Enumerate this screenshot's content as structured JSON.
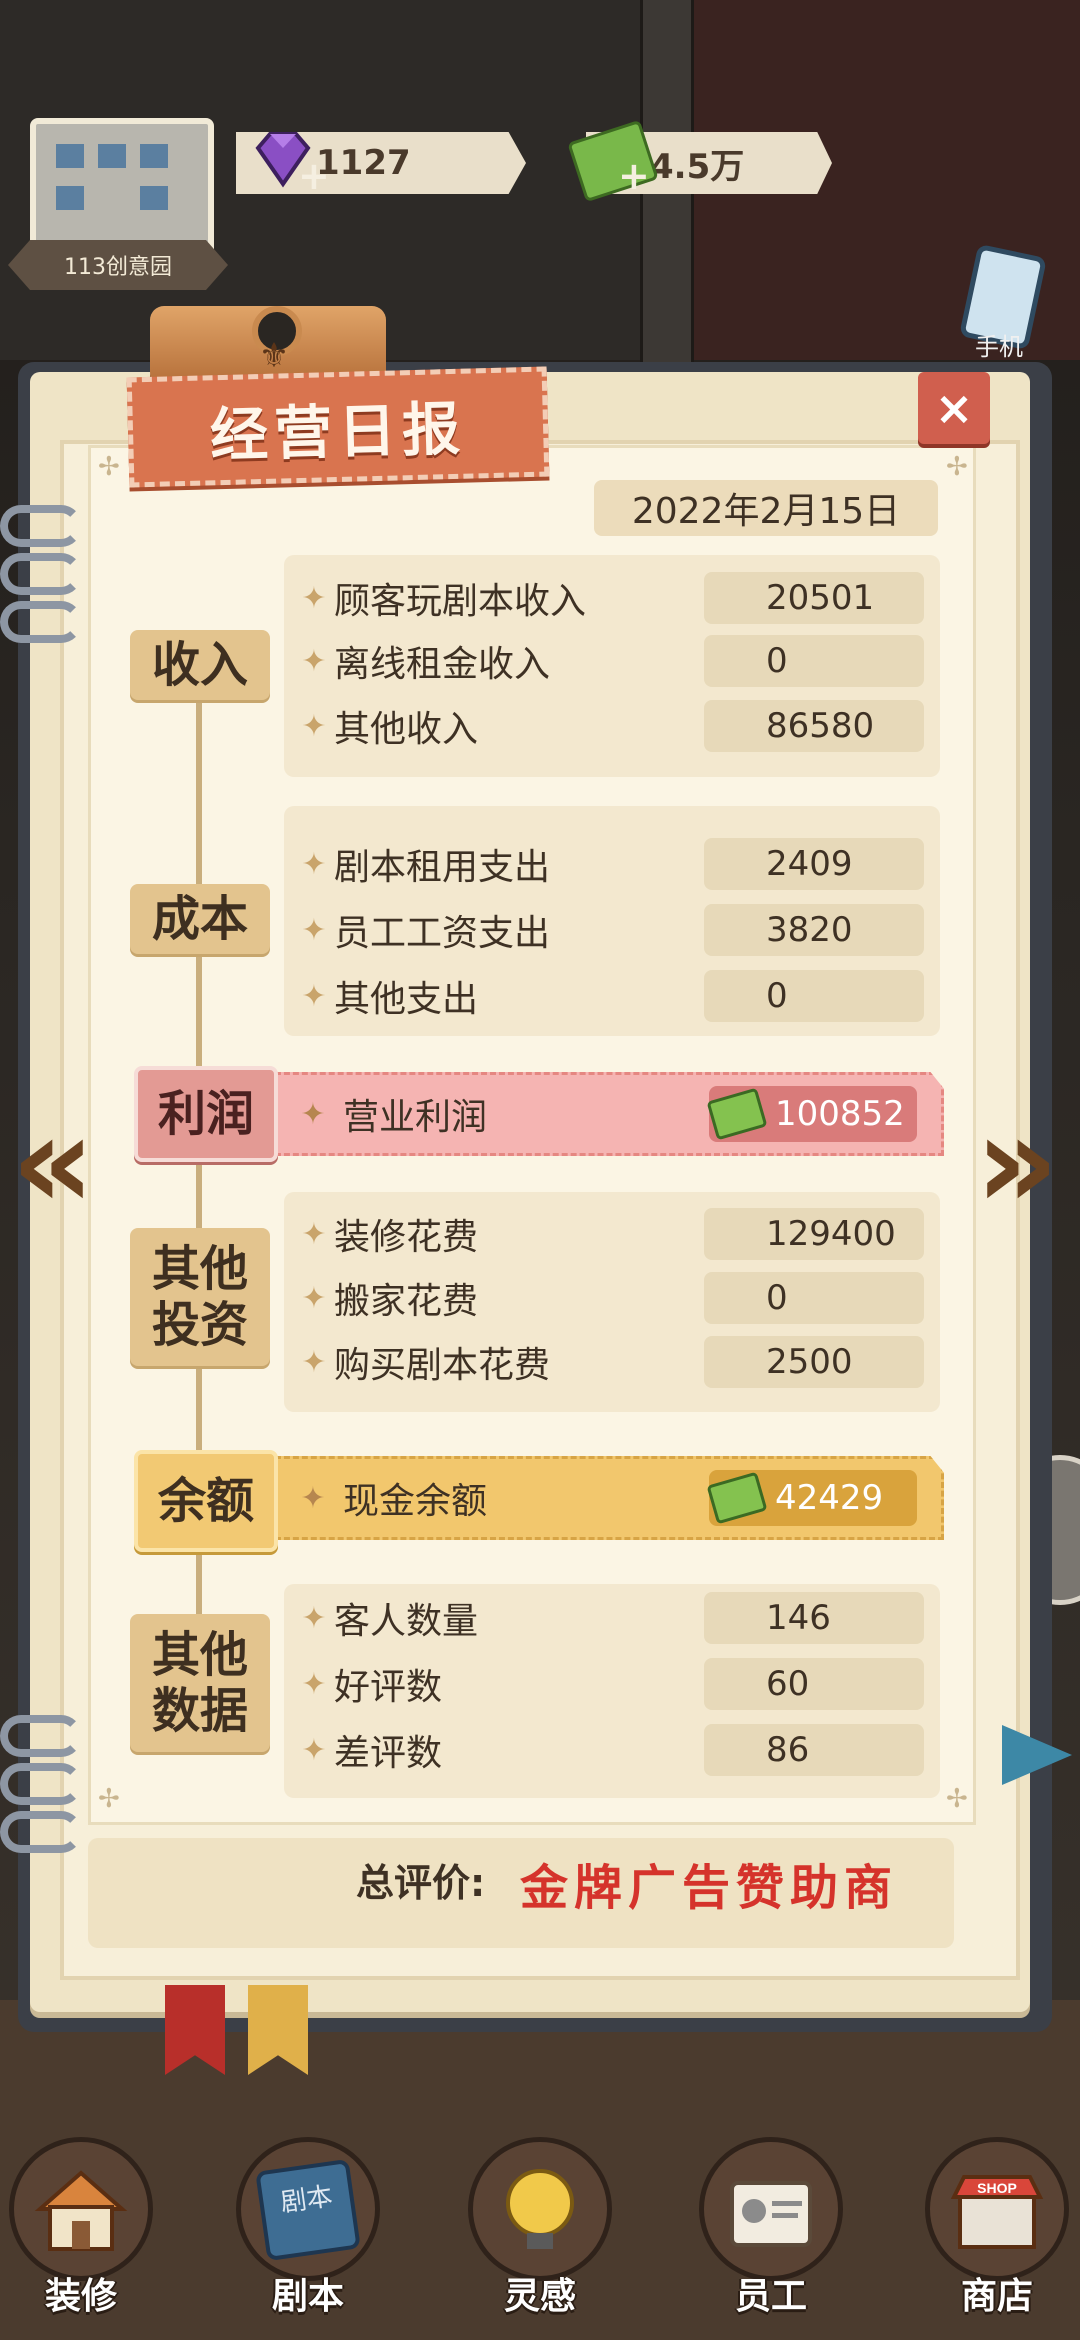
{
  "hud": {
    "building_label": "113创意园",
    "gems": "1127",
    "cash": "4.5万",
    "plus_sign": "+",
    "phone_label": "手机"
  },
  "report": {
    "title": "经营日报",
    "close_symbol": "×",
    "date": "2022年2月15日",
    "income": {
      "category": "收入",
      "rows": [
        {
          "label": "顾客玩剧本收入",
          "value": "20501"
        },
        {
          "label": "离线租金收入",
          "value": "0"
        },
        {
          "label": "其他收入",
          "value": "86580"
        }
      ]
    },
    "cost": {
      "category": "成本",
      "rows": [
        {
          "label": "剧本租用支出",
          "value": "2409"
        },
        {
          "label": "员工工资支出",
          "value": "3820"
        },
        {
          "label": "其他支出",
          "value": "0"
        }
      ]
    },
    "profit": {
      "category": "利润",
      "label": "营业利润",
      "value": "100852"
    },
    "other_invest": {
      "category": "其他投资",
      "rows": [
        {
          "label": "装修花费",
          "value": "129400"
        },
        {
          "label": "搬家花费",
          "value": "0"
        },
        {
          "label": "购买剧本花费",
          "value": "2500"
        }
      ]
    },
    "balance": {
      "category": "余额",
      "label": "现金余额",
      "value": "42429"
    },
    "other_data": {
      "category": "其他数据",
      "rows": [
        {
          "label": "客人数量",
          "value": "146"
        },
        {
          "label": "好评数",
          "value": "60"
        },
        {
          "label": "差评数",
          "value": "86"
        }
      ]
    },
    "rating_label": "总评价:",
    "rating_value": "金牌广告赞助商",
    "star_glyph": "✦",
    "prev_arrow": "«",
    "next_arrow": "»"
  },
  "toolbar": {
    "items": [
      {
        "label": "装修",
        "icon": "house-icon"
      },
      {
        "label": "剧本",
        "icon": "script-book-icon"
      },
      {
        "label": "灵感",
        "icon": "lightbulb-icon"
      },
      {
        "label": "员工",
        "icon": "staff-card-icon"
      },
      {
        "label": "商店",
        "icon": "shop-icon"
      }
    ],
    "book_label": "剧本",
    "shop_sign": "SHOP"
  },
  "colors": {
    "accent_red": "#d5332b",
    "title_banner": "#d9744f",
    "profit_pink": "#f5b4b2",
    "balance_gold": "#f2c76d",
    "paper": "#fbf5e4"
  }
}
